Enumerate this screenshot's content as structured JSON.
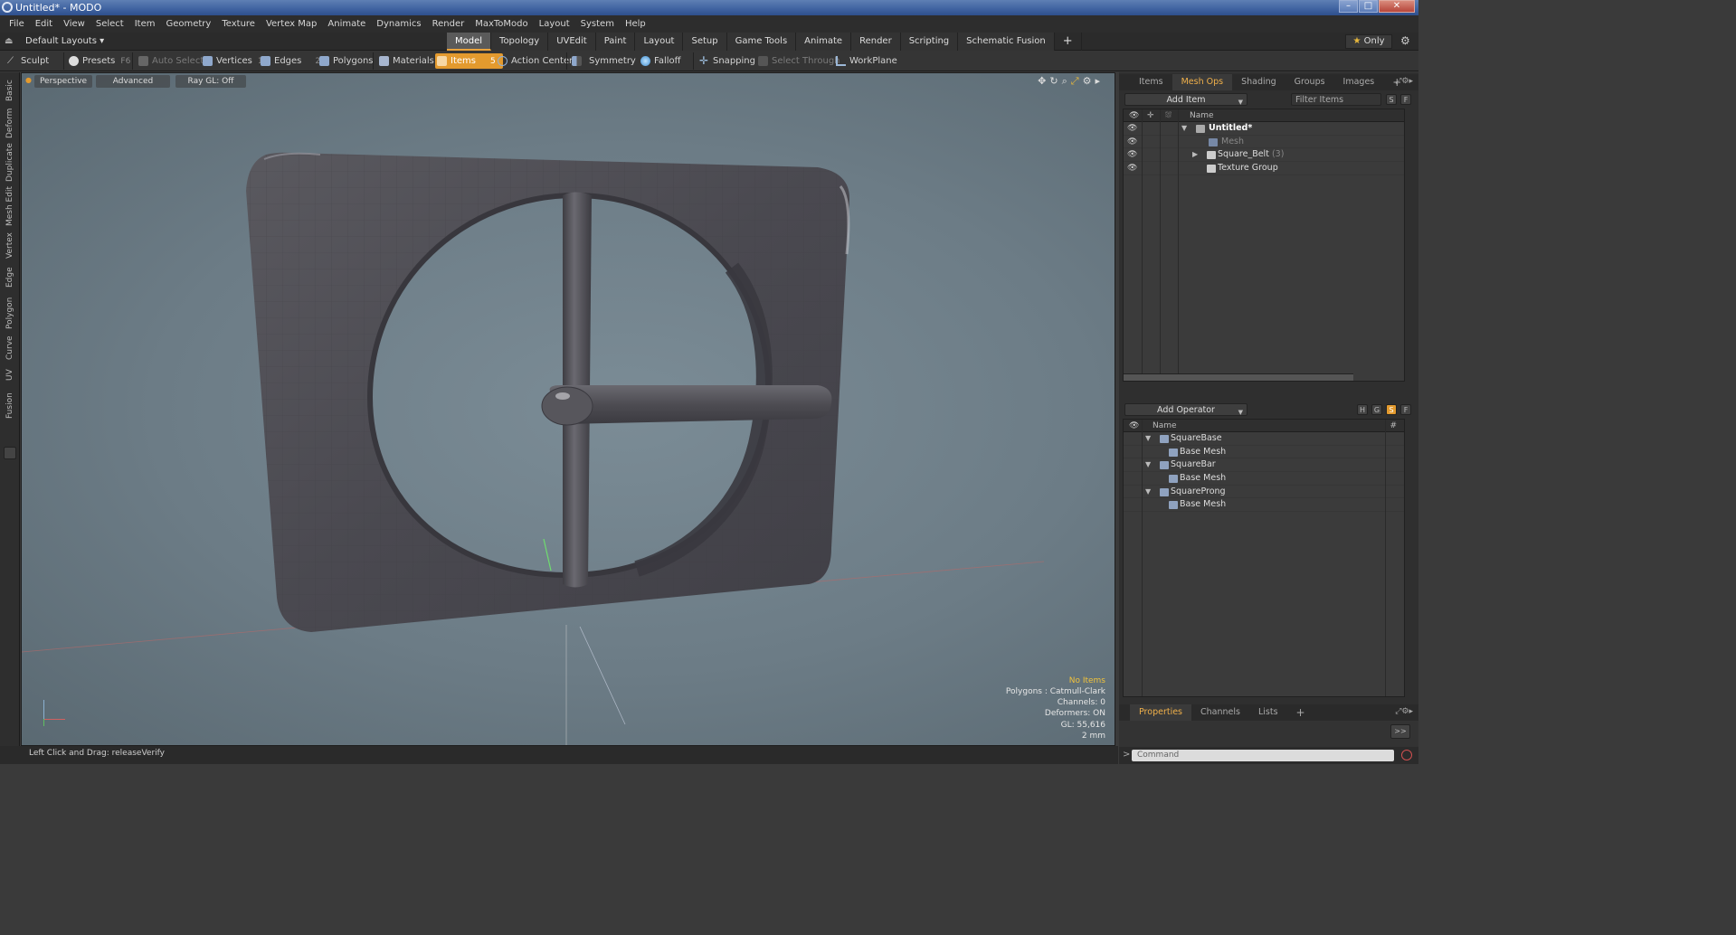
{
  "window": {
    "title": "Untitled* - MODO",
    "min": "–",
    "max": "□",
    "close": "✕"
  },
  "menubar": [
    "File",
    "Edit",
    "View",
    "Select",
    "Item",
    "Geometry",
    "Texture",
    "Vertex Map",
    "Animate",
    "Dynamics",
    "Render",
    "MaxToModo",
    "Layout",
    "System",
    "Help"
  ],
  "layoutbar": {
    "layout_selector": "Default Layouts ▾",
    "tabs": [
      "Model",
      "Topology",
      "UVEdit",
      "Paint",
      "Layout",
      "Setup",
      "Game Tools",
      "Animate",
      "Render",
      "Scripting",
      "Schematic Fusion"
    ],
    "active_tab": "Model",
    "add_tab": "+",
    "only_label": "Only",
    "only_star": "★"
  },
  "toolbar": {
    "sculpt": "Sculpt",
    "presets": "Presets",
    "presets_key": "F6",
    "auto_select": "Auto Select",
    "vertices": "Vertices",
    "vertices_key": "1",
    "edges": "Edges",
    "edges_key": "2",
    "polygons": "Polygons",
    "materials": "Materials",
    "items": "Items",
    "items_key": "5",
    "action_center": "Action Center",
    "symmetry": "Symmetry",
    "falloff": "Falloff",
    "snapping": "Snapping",
    "select_through": "Select Through",
    "workplane": "WorkPlane"
  },
  "left_tabs": [
    "Basic",
    "Deform",
    "Duplicate",
    "Mesh Edit",
    "Vertex",
    "Edge",
    "Polygon",
    "Curve",
    "UV",
    "Fusion"
  ],
  "viewport": {
    "view": "Perspective",
    "shading": "Advanced",
    "raygl": "Ray GL: Off",
    "stats": {
      "selection": "No Items",
      "polygons": "Polygons : Catmull-Clark",
      "channels": "Channels: 0",
      "deformers": "Deformers: ON",
      "gl": "GL: 55,616",
      "scale": "2 mm"
    }
  },
  "statusbar": {
    "text": "Left Click and Drag:   releaseVerify"
  },
  "items_panel": {
    "tabs": [
      "Items",
      "Mesh Ops",
      "Shading",
      "Groups",
      "Images"
    ],
    "active_tab": "Mesh Ops",
    "add_tab": "+",
    "add_item": "Add Item",
    "filter_placeholder": "Filter Items",
    "s_btn": "S",
    "f_btn": "F",
    "col_name": "Name",
    "rows": [
      {
        "label": "Untitled*",
        "bold": true
      },
      {
        "label": "Mesh",
        "dim": true
      },
      {
        "label": "Square_Belt",
        "suffix": "(3)"
      },
      {
        "label": "Texture Group"
      }
    ]
  },
  "meshops_panel": {
    "add_operator": "Add Operator",
    "h_btn": "H",
    "g_btn": "G",
    "s_btn": "S",
    "f_btn": "F",
    "col_name": "Name",
    "col_hash": "#",
    "rows": [
      {
        "label": "SquareBase",
        "level": 0
      },
      {
        "label": "Base Mesh",
        "level": 1
      },
      {
        "label": "SquareBar",
        "level": 0
      },
      {
        "label": "Base Mesh",
        "level": 1
      },
      {
        "label": "SquareProng",
        "level": 0
      },
      {
        "label": "Base Mesh",
        "level": 1
      }
    ]
  },
  "bottom_panel": {
    "tabs": [
      "Properties",
      "Channels",
      "Lists"
    ],
    "active_tab": "Properties",
    "add_tab": "+",
    "expand": ">>",
    "command_placeholder": "Command",
    "prompt": ">"
  },
  "colors": {
    "accent": "#e39a2e",
    "viewport_bg": "#6e7e88",
    "model": "#4d4c52"
  }
}
